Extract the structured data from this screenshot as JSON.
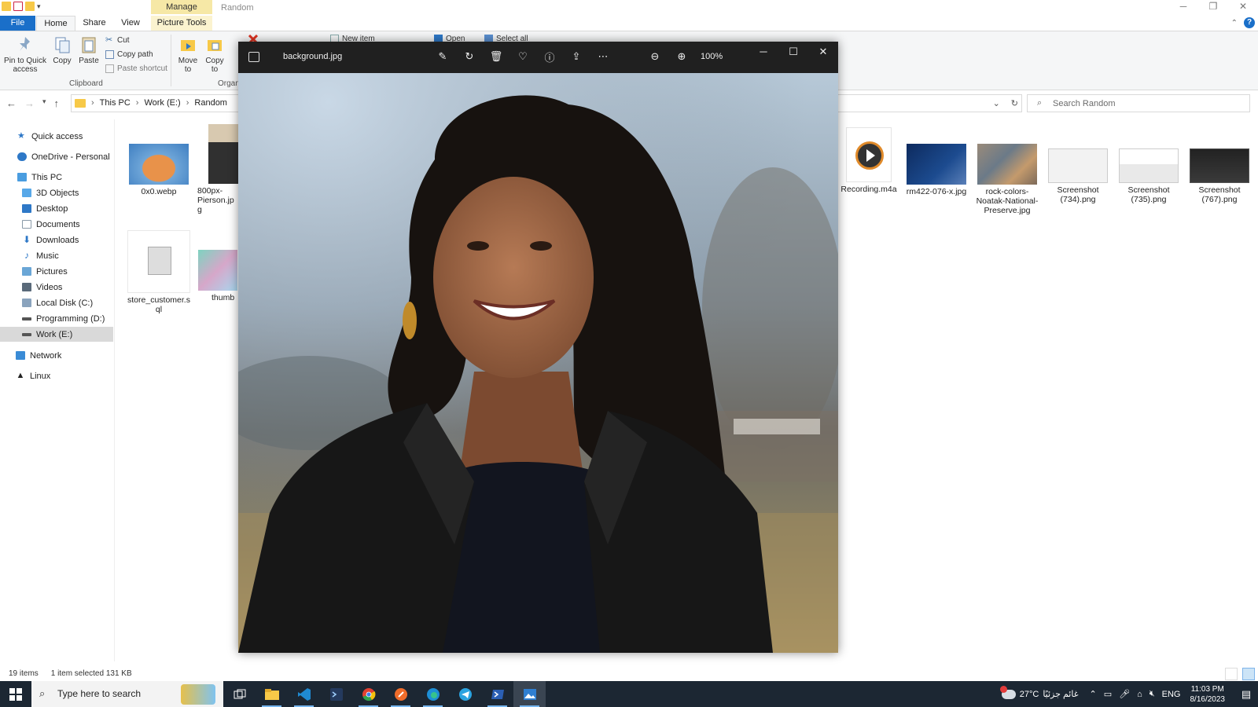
{
  "explorer": {
    "window_title": "Random",
    "context_tab": "Manage",
    "tabs": {
      "file": "File",
      "home": "Home",
      "share": "Share",
      "view": "View",
      "picture_tools": "Picture Tools"
    },
    "ribbon": {
      "pin": "Pin to Quick access",
      "copy": "Copy",
      "paste": "Paste",
      "cut": "Cut",
      "copy_path": "Copy path",
      "paste_shortcut": "Paste shortcut",
      "clipboard_group": "Clipboard",
      "move_to": "Move to",
      "copy_to": "Copy to",
      "organize_group": "Organ",
      "new_item": "New item",
      "open": "Open",
      "select_all": "Select all"
    },
    "address": {
      "crumbs": [
        "This PC",
        "Work (E:)",
        "Random"
      ],
      "search_placeholder": "Search Random"
    },
    "nav": [
      {
        "label": "Quick access",
        "icon": "star-icon"
      },
      {
        "label": "OneDrive - Personal",
        "icon": "cloud-icon"
      },
      {
        "label": "This PC",
        "icon": "computer-icon"
      },
      {
        "label": "3D Objects",
        "icon": "cube-icon"
      },
      {
        "label": "Desktop",
        "icon": "desktop-icon"
      },
      {
        "label": "Documents",
        "icon": "document-icon"
      },
      {
        "label": "Downloads",
        "icon": "download-icon"
      },
      {
        "label": "Music",
        "icon": "music-icon"
      },
      {
        "label": "Pictures",
        "icon": "picture-icon"
      },
      {
        "label": "Videos",
        "icon": "video-icon"
      },
      {
        "label": "Local Disk (C:)",
        "icon": "disk-icon"
      },
      {
        "label": "Programming (D:)",
        "icon": "drive-icon"
      },
      {
        "label": "Work (E:)",
        "icon": "drive-icon"
      },
      {
        "label": "Network",
        "icon": "network-icon"
      },
      {
        "label": "Linux",
        "icon": "linux-icon"
      }
    ],
    "files": {
      "f0x0": "0x0.webp",
      "f800": "800px-Pierson.jpg",
      "store": "store_customer.sql",
      "thumb": "thumb",
      "recording": "Recording.m4a",
      "rm422": "rm422-076-x.jpg",
      "rock": "rock-colors-Noatak-National-Preserve.jpg",
      "ss734": "Screenshot (734).png",
      "ss735": "Screenshot (735).png",
      "ss767": "Screenshot (767).png"
    },
    "status": {
      "count": "19 items",
      "selected": "1 item selected  131 KB"
    }
  },
  "viewer": {
    "filename": "background.jpg",
    "zoom": "100%"
  },
  "taskbar": {
    "search_placeholder": "Type here to search",
    "temperature": "27°C",
    "weather_text": "غائم جزئيًا",
    "language": "ENG",
    "time": "11:03 PM",
    "date": "8/16/2023"
  },
  "colors": {
    "accent": "#1a6fc9",
    "taskbar": "#1c2733",
    "viewer_chrome": "#202020",
    "manage_tab": "#f6e8a6"
  }
}
